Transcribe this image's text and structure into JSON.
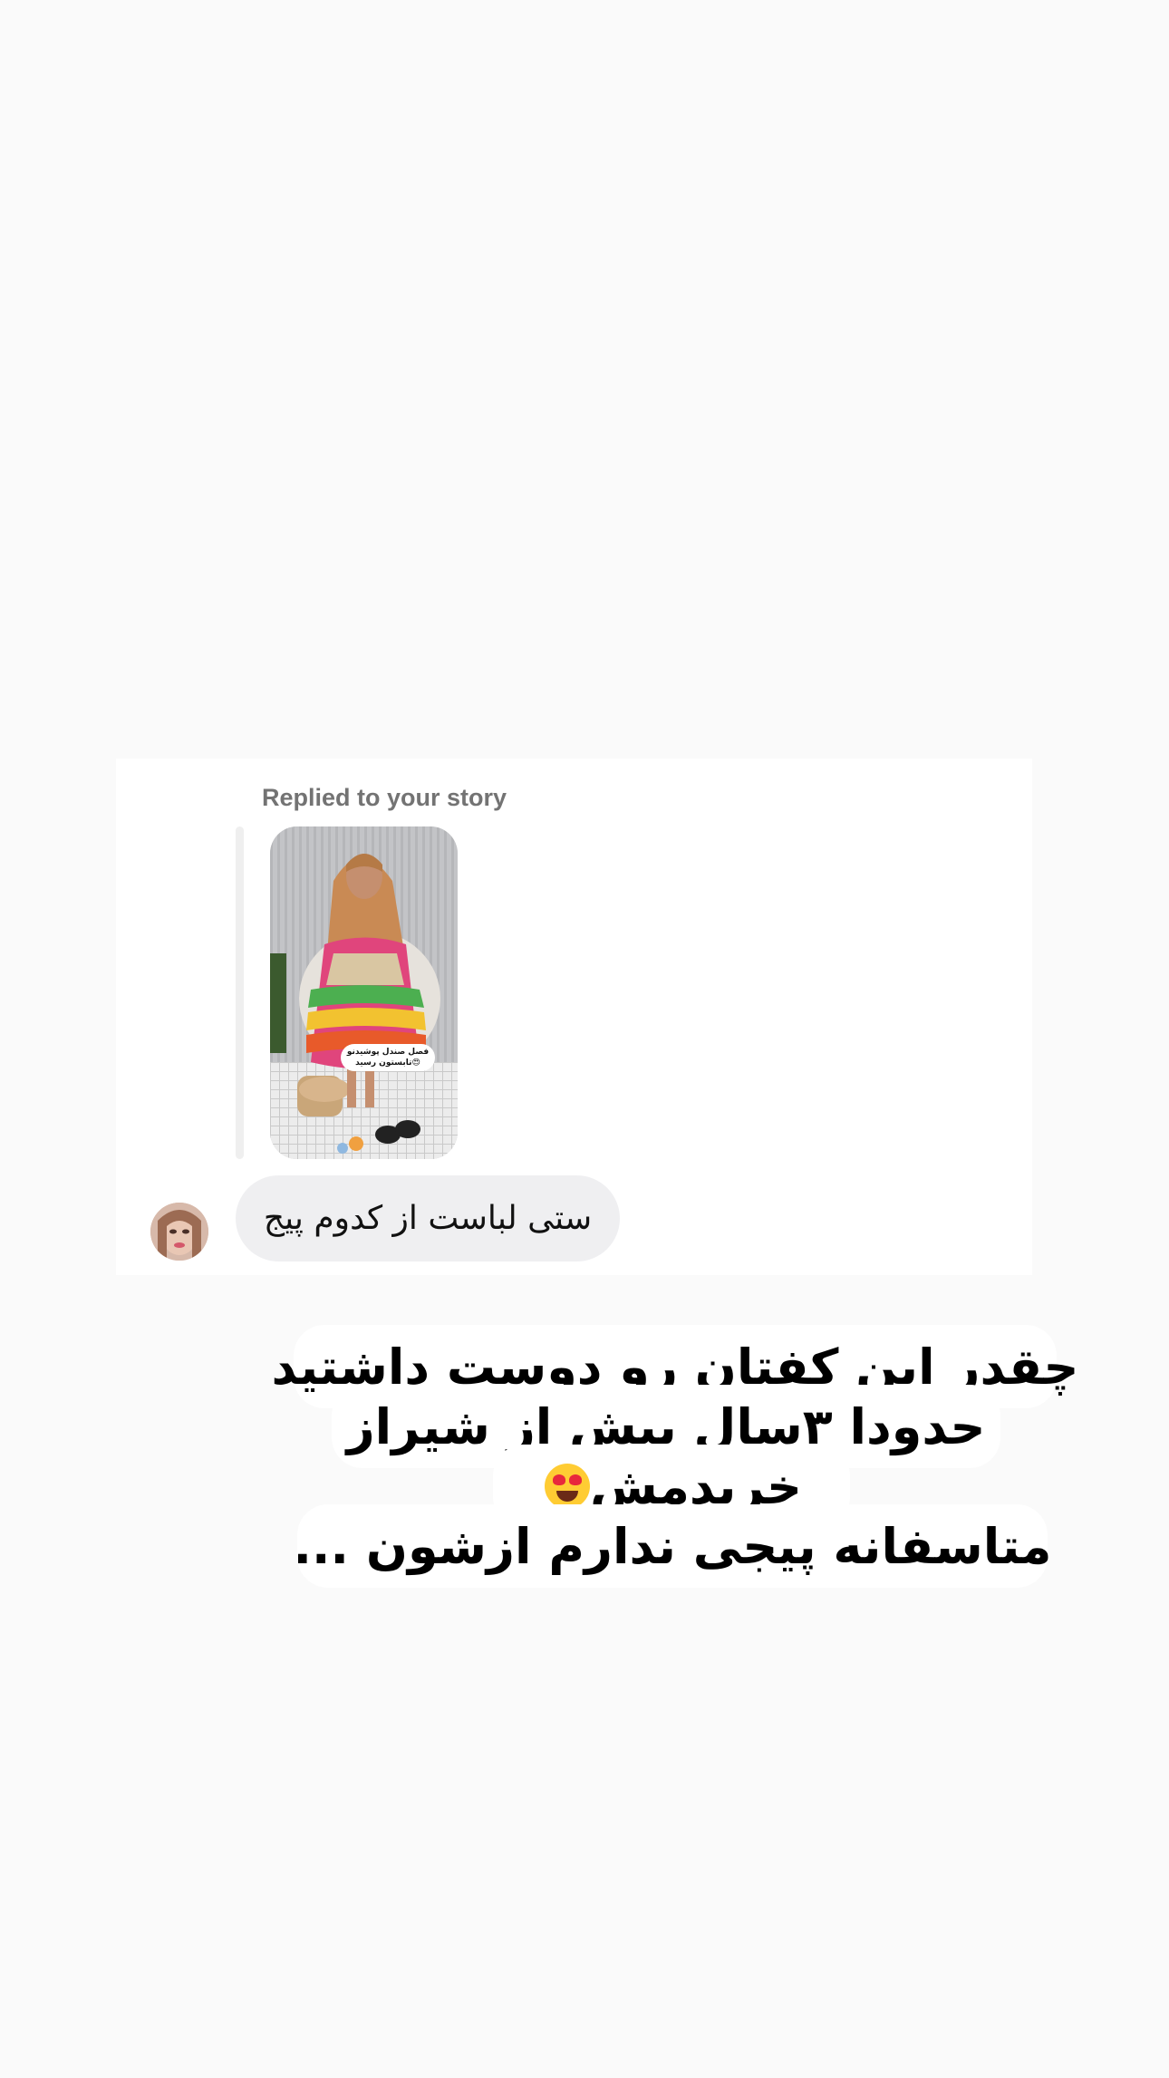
{
  "dm": {
    "reply_label": "Replied to your story",
    "story_sticker_line1": "فصل صندل پوشیدنو",
    "story_sticker_line2": "تابستون رسید😍",
    "message": "ستی لباست از کدوم پیج"
  },
  "caption": {
    "line1": "چقدر این کفتان رو دوست داشتید",
    "line2": "حدودا ۳سال پیش از شیراز",
    "line3": "خریدمش",
    "line4": "متاسفانه پیجی ندارم ازشون ...",
    "emoji_name": "heart-eyes-emoji"
  },
  "colors": {
    "background": "#fafafa",
    "card": "#ffffff",
    "bubble": "#efeff1",
    "label_gray": "#737373"
  }
}
